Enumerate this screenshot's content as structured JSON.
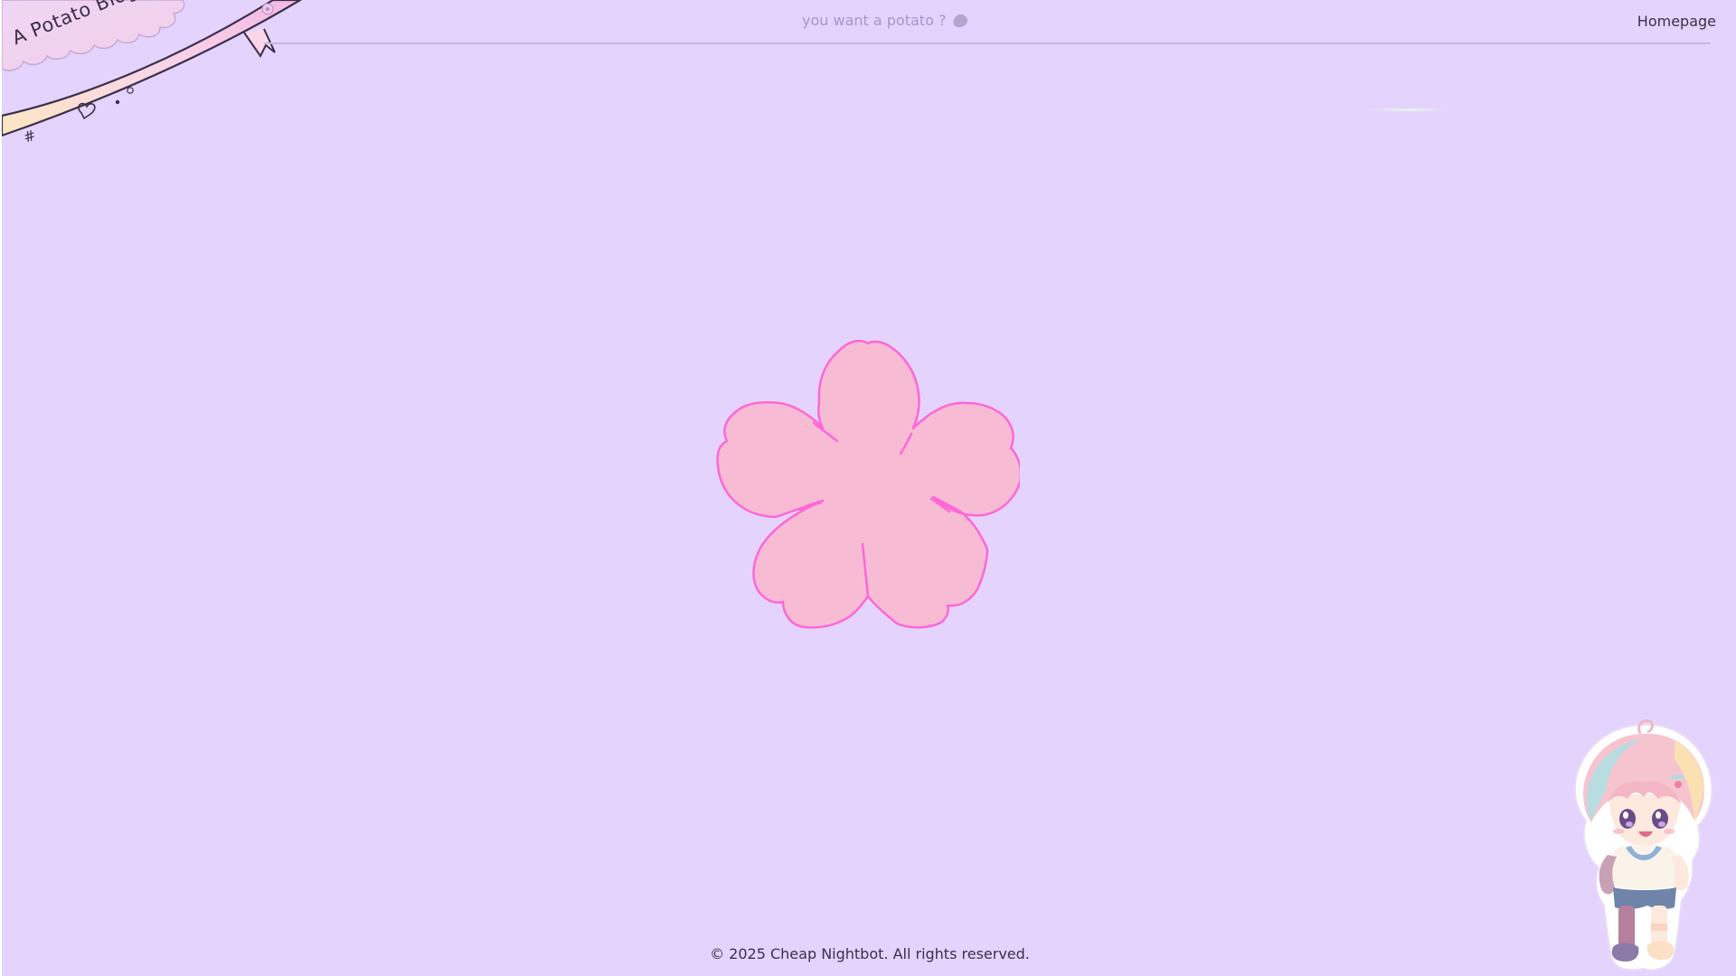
{
  "header": {
    "logo_text": "A Potato Blog ~",
    "tagline": "you want a potato ?",
    "tagline_icon": "potato-icon",
    "nav_home_label": "Homepage"
  },
  "main": {
    "center_graphic": "sakura-flower-icon"
  },
  "footer": {
    "copyright": "© 2025 Cheap Nightbot. All rights reserved."
  },
  "mascot": {
    "name": "chibi-character-illustration"
  },
  "colors": {
    "background": "#e4d4fd",
    "flower_fill": "#f7bcd4",
    "flower_stroke": "#ff66d9",
    "text_dark": "#3c2f4c",
    "text_muted": "#a994c8"
  }
}
